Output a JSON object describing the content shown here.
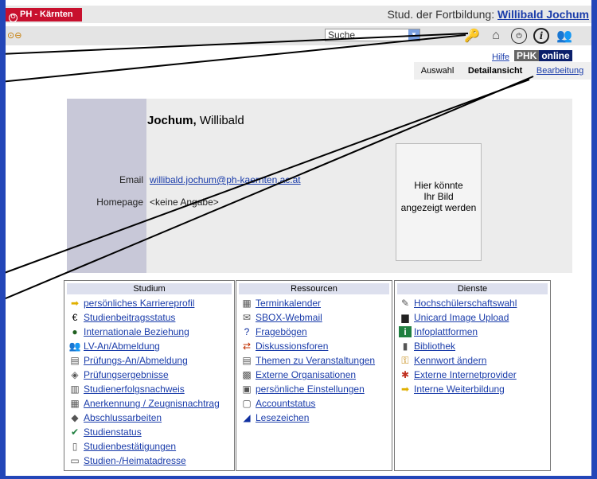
{
  "app": {
    "brand": "PH - Kärnten",
    "user_prefix": "Stud. der Fortbildung: ",
    "user_name": "Willibald Jochum",
    "search_placeholder": "Suche"
  },
  "nav": {
    "hilfe": "Hilfe",
    "logo_a": "PHK",
    "logo_b": "online",
    "tab_auswahl": "Auswahl",
    "tab_detail": "Detailansicht",
    "tab_bearbeitung": "Bearbeitung"
  },
  "profile": {
    "surname": "Jochum,",
    "firstname": " Willibald",
    "email_label": "Email",
    "email_value": "willibald.jochum@ph-kaernten.ac.at",
    "homepage_label": "Homepage",
    "homepage_value": "<keine Angabe>",
    "photo_placeholder_1": "Hier könnte",
    "photo_placeholder_2": "Ihr Bild",
    "photo_placeholder_3": "angezeigt werden"
  },
  "columns": [
    {
      "title": "Studium",
      "items": [
        {
          "icon": "arrow-icon",
          "label": "persönliches Karriereprofil"
        },
        {
          "icon": "euro-icon",
          "label": "Studienbeitragsstatus"
        },
        {
          "icon": "globe-icon",
          "label": "Internationale Beziehung"
        },
        {
          "icon": "people-icon",
          "label": "LV-An/Abmeldung"
        },
        {
          "icon": "exam-icon",
          "label": "Prüfungs-An/Abmeldung"
        },
        {
          "icon": "result-icon",
          "label": "Prüfungsergebnisse"
        },
        {
          "icon": "certificate-icon",
          "label": "Studienerfolgsnachweis"
        },
        {
          "icon": "document-icon",
          "label": "Anerkennung / Zeugnisnachtrag"
        },
        {
          "icon": "graduation-cap-icon",
          "label": "Abschlussarbeiten"
        },
        {
          "icon": "status-icon",
          "label": "Studienstatus"
        },
        {
          "icon": "confirmation-icon",
          "label": "Studienbestätigungen"
        },
        {
          "icon": "address-icon",
          "label": "Studien-/Heimatadresse"
        }
      ]
    },
    {
      "title": "Ressourcen",
      "items": [
        {
          "icon": "calendar-icon",
          "label": "Terminkalender"
        },
        {
          "icon": "mail-icon",
          "label": "SBOX-Webmail"
        },
        {
          "icon": "question-icon",
          "label": "Fragebögen"
        },
        {
          "icon": "forum-icon",
          "label": "Diskussionsforen"
        },
        {
          "icon": "presentation-icon",
          "label": "Themen zu Veranstaltungen"
        },
        {
          "icon": "organization-icon",
          "label": "Externe Organisationen"
        },
        {
          "icon": "settings-icon",
          "label": "persönliche Einstellungen"
        },
        {
          "icon": "account-icon",
          "label": "Accountstatus"
        },
        {
          "icon": "bookmark-icon",
          "label": "Lesezeichen"
        }
      ]
    },
    {
      "title": "Dienste",
      "items": [
        {
          "icon": "ballot-icon",
          "label": "Hochschülerschaftswahl"
        },
        {
          "icon": "camera-icon",
          "label": "Unicard Image Upload"
        },
        {
          "icon": "info-icon",
          "label": "Infoplattformen"
        },
        {
          "icon": "library-icon",
          "label": "Bibliothek"
        },
        {
          "icon": "key-icon",
          "label": "Kennwort ändern"
        },
        {
          "icon": "network-icon",
          "label": "Externe Internetprovider"
        },
        {
          "icon": "arrow-icon",
          "label": "Interne Weiterbildung"
        }
      ]
    }
  ]
}
